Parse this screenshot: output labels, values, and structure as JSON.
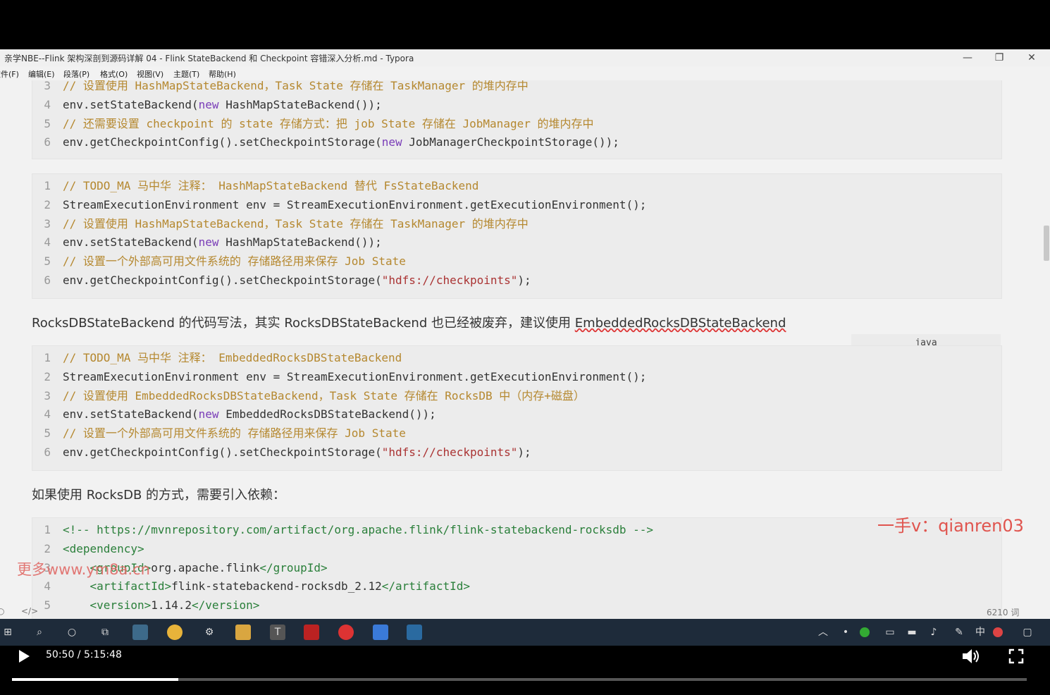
{
  "window": {
    "title": "亲学NBE--Flink 架构深剖到源码详解 04 - Flink StateBackend 和 Checkpoint 容错深入分析.md - Typora",
    "minimize_glyph": "—",
    "maximize_glyph": "❐",
    "close_glyph": "✕"
  },
  "menu": [
    "文件(F)",
    "编辑(E)",
    "段落(P)",
    "格式(O)",
    "视图(V)",
    "主题(T)",
    "帮助(H)"
  ],
  "blocks": {
    "b0": {
      "lines": [
        {
          "n": "3",
          "segs": [
            [
              "cm",
              "// 设置使用 HashMapStateBackend，Task State 存储在 TaskManager 的堆内存中"
            ]
          ]
        },
        {
          "n": "4",
          "segs": [
            [
              "",
              "env.setStateBackend("
            ],
            [
              "kw",
              "new"
            ],
            [
              "",
              " HashMapStateBackend());"
            ]
          ]
        },
        {
          "n": "5",
          "segs": [
            [
              "cm",
              "// 还需要设置 checkpoint 的 state 存储方式：把 job State 存储在 JobManager 的堆内存中"
            ]
          ]
        },
        {
          "n": "6",
          "segs": [
            [
              "",
              "env.getCheckpointConfig().setCheckpointStorage("
            ],
            [
              "kw",
              "new"
            ],
            [
              "",
              " JobManagerCheckpointStorage());"
            ]
          ]
        }
      ]
    },
    "b1": {
      "lines": [
        {
          "n": "1",
          "segs": [
            [
              "cm",
              "// TODO_MA 马中华 注释： HashMapStateBackend 替代 FsStateBackend"
            ]
          ]
        },
        {
          "n": "2",
          "segs": [
            [
              "",
              "StreamExecutionEnvironment env = StreamExecutionEnvironment.getExecutionEnvironment();"
            ]
          ]
        },
        {
          "n": "3",
          "segs": [
            [
              "cm",
              "// 设置使用 HashMapStateBackend，Task State 存储在 TaskManager 的堆内存中"
            ]
          ]
        },
        {
          "n": "4",
          "segs": [
            [
              "",
              "env.setStateBackend("
            ],
            [
              "kw",
              "new"
            ],
            [
              "",
              " HashMapStateBackend());"
            ]
          ]
        },
        {
          "n": "5",
          "segs": [
            [
              "cm",
              "// 设置一个外部高可用文件系统的 存储路径用来保存 Job State"
            ]
          ]
        },
        {
          "n": "6",
          "segs": [
            [
              "",
              "env.getCheckpointConfig().setCheckpointStorage("
            ],
            [
              "st",
              "\"hdfs://checkpoints\""
            ],
            [
              "",
              ");"
            ]
          ]
        }
      ]
    },
    "lang_label": "java",
    "para1_prefix": "RocksDBStateBackend 的代码写法，其实 RocksDBStateBackend 也已经被废弃，建议使用 ",
    "para1_link": "EmbeddedRocksDBStateBackend",
    "b2": {
      "lines": [
        {
          "n": "1",
          "segs": [
            [
              "cm",
              "// TODO_MA 马中华 注释： EmbeddedRocksDBStateBackend"
            ]
          ]
        },
        {
          "n": "2",
          "segs": [
            [
              "",
              "StreamExecutionEnvironment env = StreamExecutionEnvironment.getExecutionEnvironment();"
            ]
          ]
        },
        {
          "n": "3",
          "segs": [
            [
              "cm",
              "// 设置使用 EmbeddedRocksDBStateBackend，Task State 存储在 RocksDB 中（内存+磁盘）"
            ]
          ]
        },
        {
          "n": "4",
          "segs": [
            [
              "",
              "env.setStateBackend("
            ],
            [
              "kw",
              "new"
            ],
            [
              "",
              " EmbeddedRocksDBStateBackend());"
            ]
          ]
        },
        {
          "n": "5",
          "segs": [
            [
              "cm",
              "// 设置一个外部高可用文件系统的 存储路径用来保存 Job State"
            ]
          ]
        },
        {
          "n": "6",
          "segs": [
            [
              "",
              "env.getCheckpointConfig().setCheckpointStorage("
            ],
            [
              "st",
              "\"hdfs://checkpoints\""
            ],
            [
              "",
              ");"
            ]
          ]
        }
      ]
    },
    "para2": "如果使用 RocksDB 的方式，需要引入依赖：",
    "b3": {
      "lines": [
        {
          "n": "1",
          "segs": [
            [
              "tg",
              "<!-- https://mvnrepository.com/artifact/org.apache.flink/flink-statebackend-rocksdb -->"
            ]
          ]
        },
        {
          "n": "2",
          "segs": [
            [
              "tg",
              "<dependency>"
            ]
          ]
        },
        {
          "n": "3",
          "segs": [
            [
              "tg",
              "    <groupId>"
            ],
            [
              "",
              "org.apache.flink"
            ],
            [
              "tg",
              "</groupId>"
            ]
          ]
        },
        {
          "n": "4",
          "segs": [
            [
              "tg",
              "    <artifactId>"
            ],
            [
              "",
              "flink-statebackend-rocksdb_2.12"
            ],
            [
              "tg",
              "</artifactId>"
            ]
          ]
        },
        {
          "n": "5",
          "segs": [
            [
              "tg",
              "    <version>"
            ],
            [
              "",
              "1.14.2"
            ],
            [
              "tg",
              "</version>"
            ]
          ]
        }
      ]
    }
  },
  "watermark_contact": "一手v：qianren03",
  "watermark_site": "更多www.ym8a.cn",
  "status": {
    "word_count": "6210 词",
    "source_toggle": "</>"
  },
  "player": {
    "time": "50:50 / 5:15:48",
    "progress": 0.164
  },
  "taskbar_icons": [
    "windows-start-icon",
    "search-icon",
    "cortana-icon",
    "task-view-icon",
    "app-icon",
    "chrome-icon",
    "app-icon",
    "folder-icon",
    "typora-icon",
    "idea-icon",
    "netease-music-icon",
    "app-icon",
    "image-viewer-icon"
  ]
}
